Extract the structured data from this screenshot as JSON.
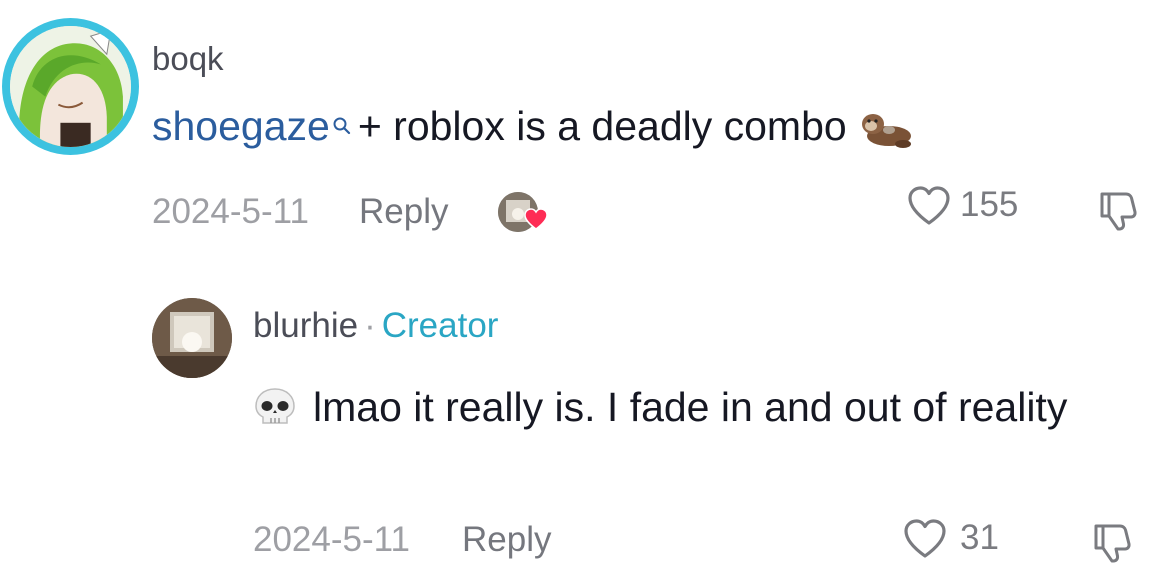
{
  "comment": {
    "username": "boqk",
    "search_term": "shoegaze",
    "text": "+ roblox is a deadly combo",
    "date": "2024-5-11",
    "reply_label": "Reply",
    "like_count": "155",
    "emoji": "otter",
    "icons": [
      "search-icon",
      "heart-icon",
      "dislike-icon",
      "creator-liked-avatar"
    ]
  },
  "reply": {
    "username": "blurhie",
    "separator": "·",
    "badge": "Creator",
    "text": "lmao it really is. I fade in and out of reality",
    "emoji": "skull",
    "date": "2024-5-11",
    "reply_label": "Reply",
    "like_count": "31"
  },
  "colors": {
    "link": "#2b5d9e",
    "creator": "#2aa6c4",
    "avatar_ring": "#3cc2e0",
    "meta": "#9e9fa4",
    "liked_heart": "#fe2c55"
  }
}
